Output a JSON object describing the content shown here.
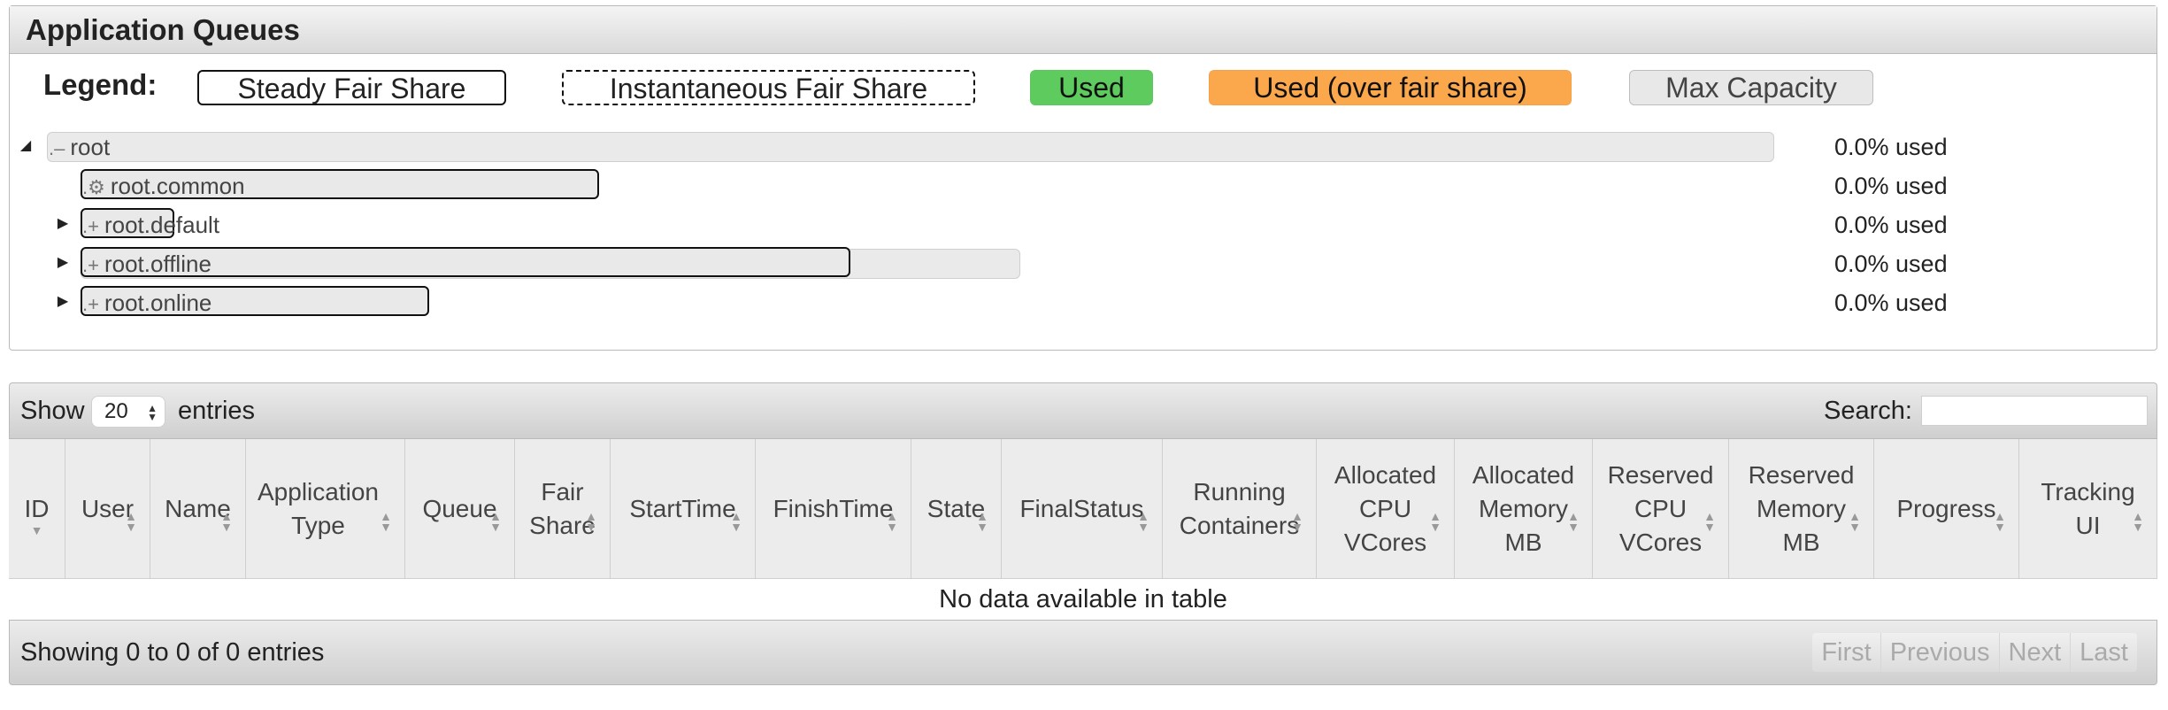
{
  "queues": {
    "title": "Application Queues",
    "legend": {
      "label": "Legend:",
      "steady_fair_share": "Steady Fair Share",
      "instantaneous_fair_share": "Instantaneous Fair Share",
      "used": "Used",
      "used_over_fair_share": "Used (over fair share)",
      "max_capacity": "Max Capacity"
    },
    "items": [
      {
        "name": "root",
        "icon": "minus-icon",
        "expanded": true,
        "used": "0.0% used"
      },
      {
        "name": "root.common",
        "icon": "gear-icon",
        "used": "0.0% used"
      },
      {
        "name": "root.default",
        "icon": "plus-icon",
        "expanded": false,
        "used": "0.0% used"
      },
      {
        "name": "root.offline",
        "icon": "plus-icon",
        "expanded": false,
        "used": "0.0% used"
      },
      {
        "name": "root.online",
        "icon": "plus-icon",
        "expanded": false,
        "used": "0.0% used"
      }
    ]
  },
  "apps": {
    "show_label": "Show",
    "page_size": "20",
    "entries_label": "entries",
    "search_label": "Search:",
    "search_value": "",
    "columns": [
      "ID",
      "User",
      "Name",
      "Application Type",
      "Queue",
      "Fair Share",
      "StartTime",
      "FinishTime",
      "State",
      "FinalStatus",
      "Running Containers",
      "Allocated CPU VCores",
      "Allocated Memory MB",
      "Reserved CPU VCores",
      "Reserved Memory MB",
      "Progress",
      "Tracking UI"
    ],
    "empty_message": "No data available in table",
    "info": "Showing 0 to 0 of 0 entries",
    "pagination": {
      "first": "First",
      "previous": "Previous",
      "next": "Next",
      "last": "Last"
    }
  },
  "colors": {
    "used": "#5ecb5e",
    "over_fair_share": "#fba84d",
    "max_capacity": "#e8e8e8"
  }
}
